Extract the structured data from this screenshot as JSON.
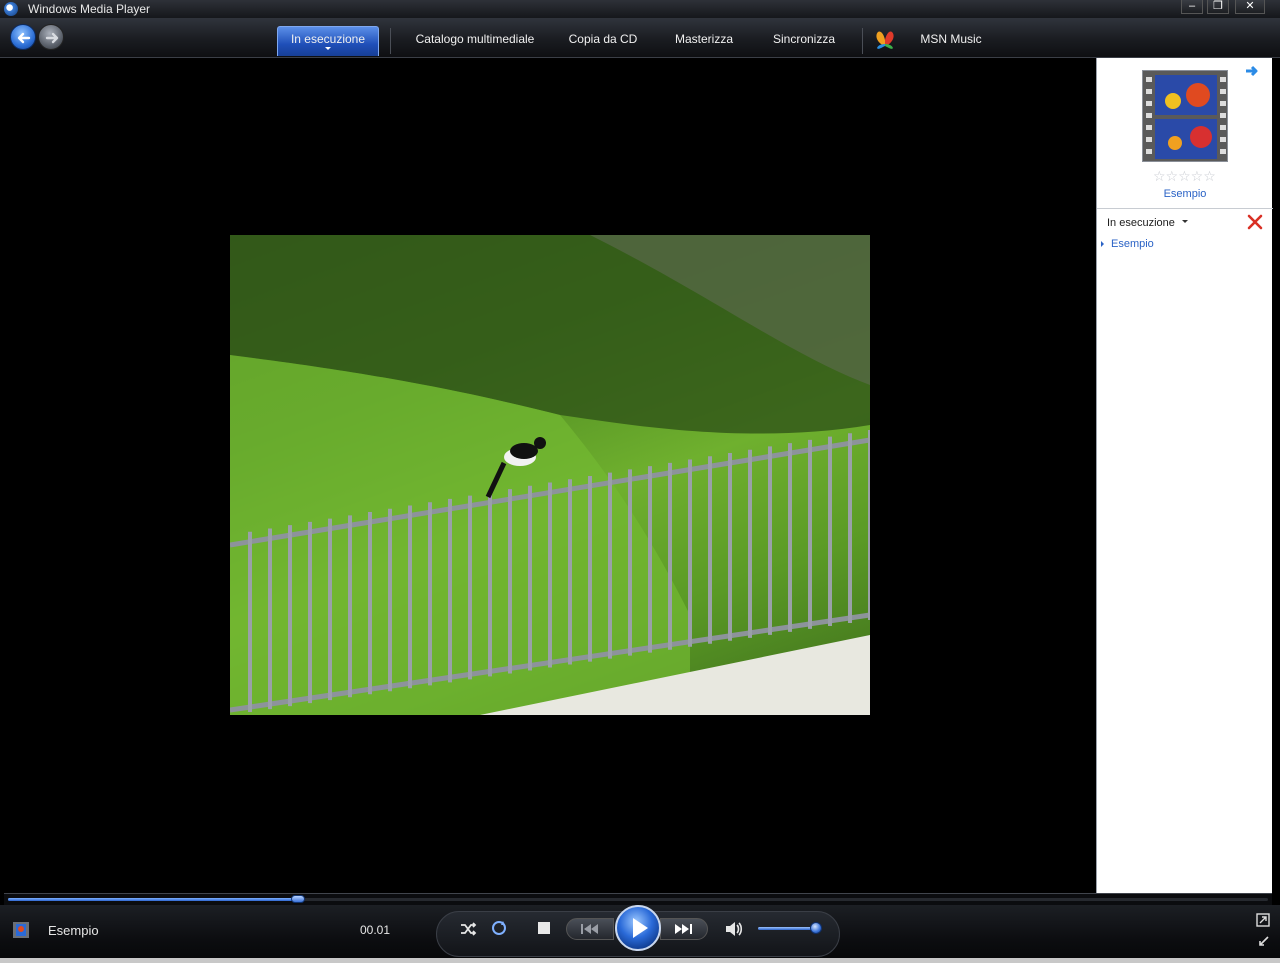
{
  "window": {
    "title": "Windows Media Player",
    "minimize_glyph": "–",
    "restore_glyph": "❐",
    "close_glyph": "✕"
  },
  "nav": {
    "tabs": [
      {
        "label": "In esecuzione",
        "active": true
      },
      {
        "label": "Catalogo multimediale",
        "active": false
      },
      {
        "label": "Copia da CD",
        "active": false
      },
      {
        "label": "Masterizza",
        "active": false
      },
      {
        "label": "Sincronizza",
        "active": false
      },
      {
        "label": "MSN Music",
        "active": false
      }
    ]
  },
  "right_pane": {
    "art_title": "Esempio",
    "rating_stars": "☆☆☆☆☆",
    "list_header": "In esecuzione",
    "list_items": [
      "Esempio"
    ]
  },
  "player": {
    "now_playing_title": "Esempio",
    "elapsed": "00.01",
    "seek_progress": 0.23,
    "volume": 0.9
  },
  "colors": {
    "accent": "#2e66cf",
    "link": "#2b63c6",
    "close_red": "#d93025"
  },
  "icons": {
    "back": "arrow-left-icon",
    "forward": "arrow-right-icon",
    "shuffle": "shuffle-icon",
    "repeat": "repeat-icon",
    "stop": "stop-icon",
    "prev": "previous-icon",
    "play": "play-icon",
    "next": "next-icon",
    "mute": "speaker-icon",
    "switch": "switch-to-compact-icon",
    "fullscreen": "fullscreen-icon"
  }
}
